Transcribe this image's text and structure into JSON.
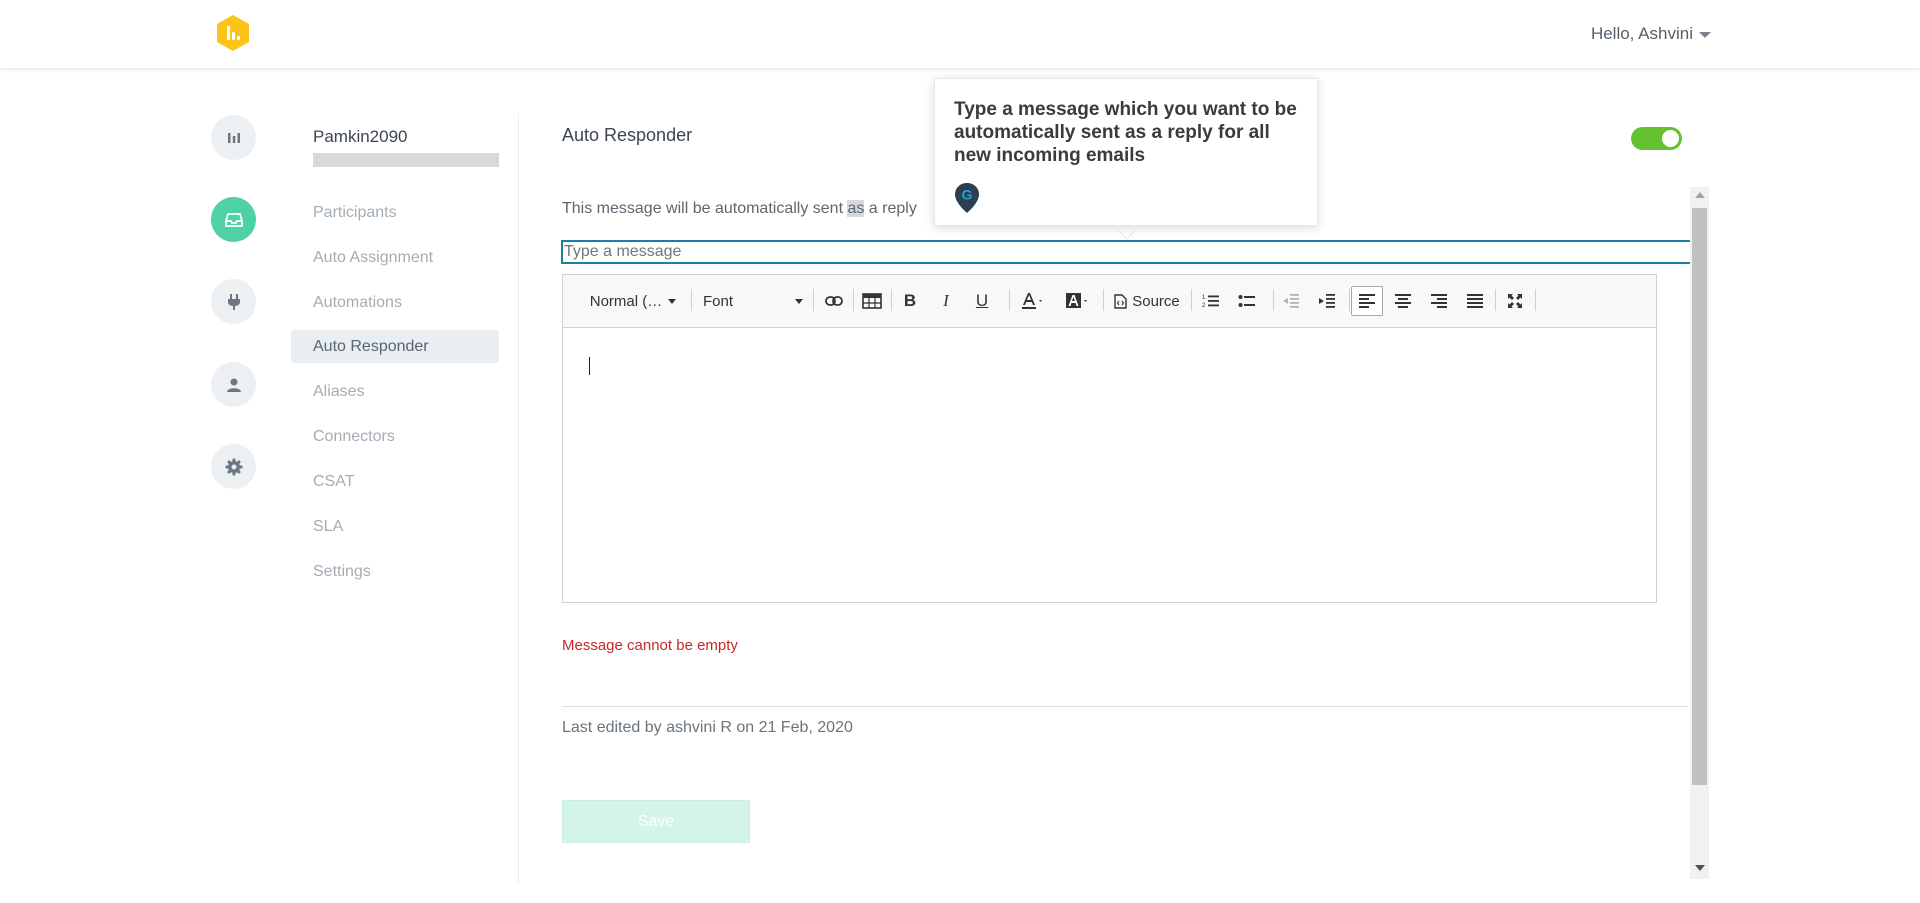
{
  "header": {
    "greeting": "Hello, Ashvini",
    "brand_color": "#fcc419"
  },
  "rail": {
    "items": [
      {
        "icon": "analytics-icon",
        "active": false
      },
      {
        "icon": "inbox-icon",
        "active": true
      },
      {
        "icon": "plug-icon",
        "active": false
      },
      {
        "icon": "user-icon",
        "active": false
      },
      {
        "icon": "gear-icon",
        "active": false
      }
    ],
    "active_color": "#4fd1a5"
  },
  "subnav": {
    "title": "Pamkin2090",
    "items": [
      {
        "label": "Participants"
      },
      {
        "label": "Auto Assignment"
      },
      {
        "label": "Automations"
      },
      {
        "label": "Auto Responder"
      },
      {
        "label": "Aliases"
      },
      {
        "label": "Connectors"
      },
      {
        "label": "CSAT"
      },
      {
        "label": "SLA"
      },
      {
        "label": "Settings"
      }
    ]
  },
  "main": {
    "title": "Auto Responder",
    "toggle_on": true,
    "toggle_color": "#63c132",
    "description_part1": "This message will be automatically sent ",
    "description_highlight": "as",
    "description_part2": " a reply",
    "message_placeholder": "Type a message",
    "error": "Message cannot be empty",
    "last_edited": "Last edited by  ashvini R on 21 Feb, 2020",
    "save_label": "Save"
  },
  "editor": {
    "format_label": "Normal (…",
    "font_label": "Font",
    "source_label": "Source"
  },
  "tooltip": {
    "text": "Type a message which you want to be automatically sent as a reply for all new incoming emails"
  }
}
